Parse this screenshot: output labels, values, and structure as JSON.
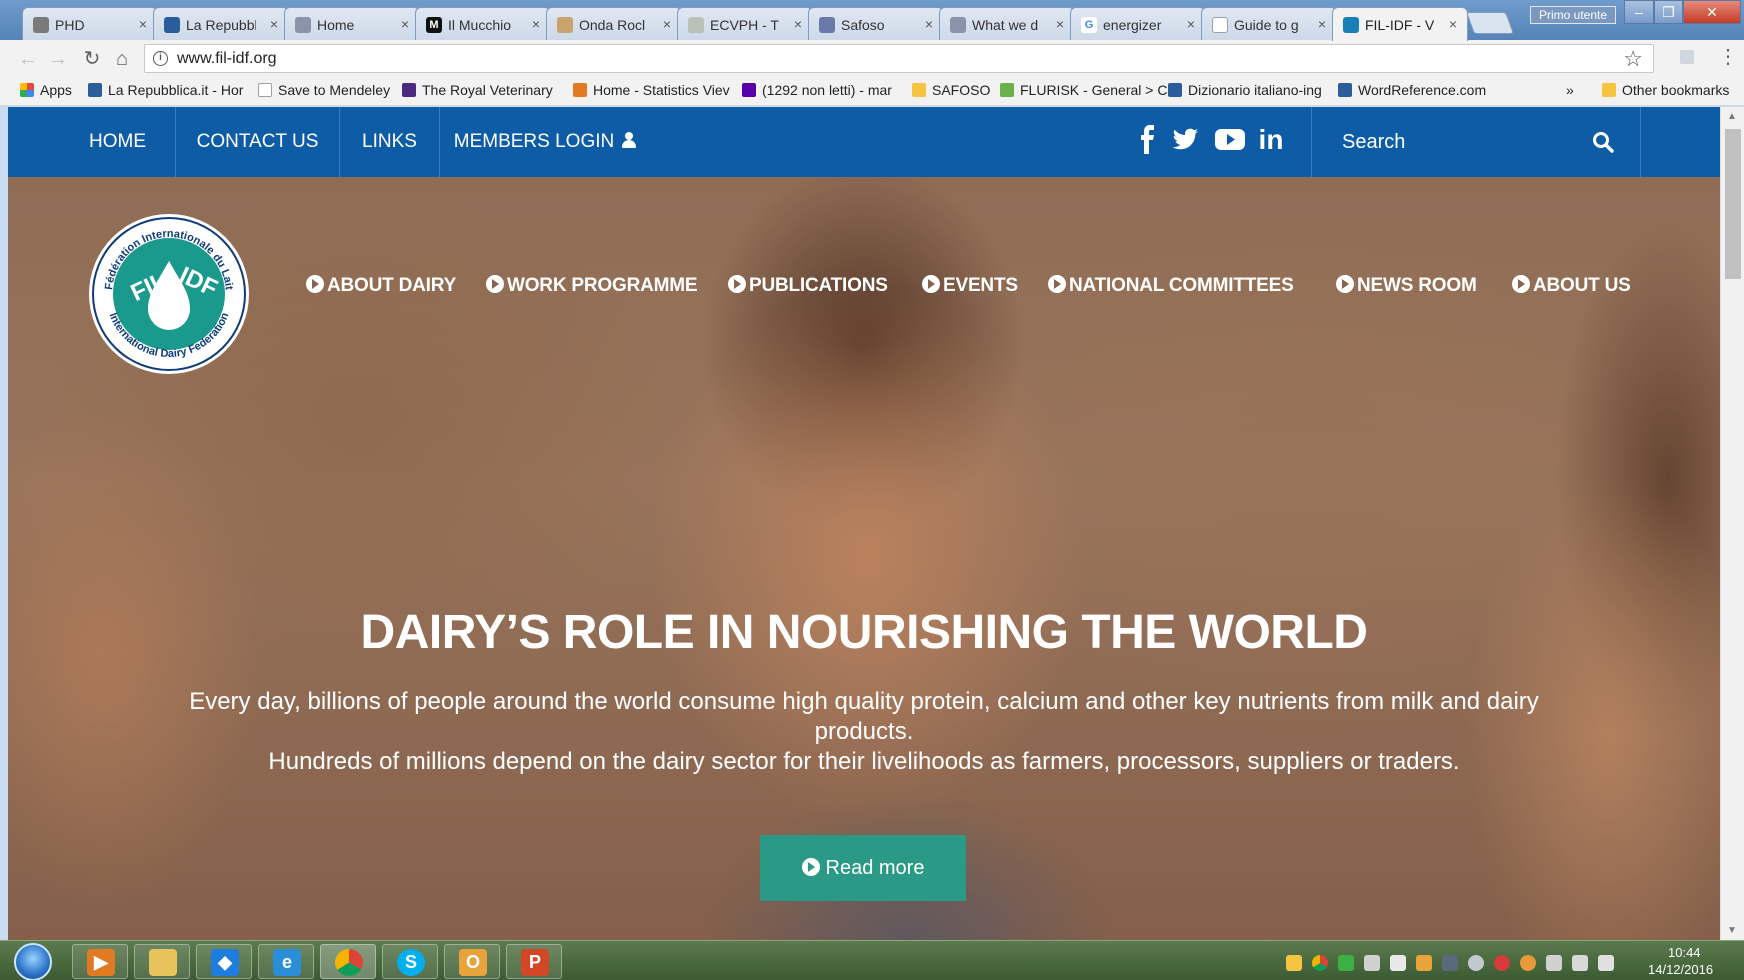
{
  "browser": {
    "tabs": [
      {
        "title": "PHD",
        "icon_color": "#7a7a7a"
      },
      {
        "title": "La Repubbl",
        "icon_color": "#2b5d9a"
      },
      {
        "title": "Home",
        "icon_color": "#8a93a8"
      },
      {
        "title": "Il Mucchio",
        "icon_color": "#111111"
      },
      {
        "title": "Onda Rocl",
        "icon_color": "#c8a46a"
      },
      {
        "title": "ECVPH - T",
        "icon_color": "#b8c0b8"
      },
      {
        "title": "Safoso",
        "icon_color": "#6a7aa8"
      },
      {
        "title": "What we d",
        "icon_color": "#8a93a8"
      },
      {
        "title": "energizer",
        "icon_color": "#4285f4"
      },
      {
        "title": "Guide to g",
        "icon_color": "#9aa0a6"
      },
      {
        "title": "FIL-IDF - V",
        "icon_color": "#1a7fb8"
      }
    ],
    "tab_close_glyph": "×",
    "profile_name": "Primo utente",
    "url": "www.fil-idf.org",
    "bookmarks": [
      {
        "label": "Apps",
        "icon_color": "#e34b3c"
      },
      {
        "label": "La Repubblica.it - Hor",
        "icon_color": "#2b5d9a"
      },
      {
        "label": "Save to Mendeley",
        "icon_color": "#9aa0a6"
      },
      {
        "label": "The Royal Veterinary",
        "icon_color": "#4b2a7f"
      },
      {
        "label": "Home - Statistics Viev",
        "icon_color": "#e07b24"
      },
      {
        "label": "(1292 non letti) - mar",
        "icon_color": "#5a00a8"
      },
      {
        "label": "SAFOSO",
        "icon_color": "#f5c542"
      },
      {
        "label": "FLURISK - General > C",
        "icon_color": "#6ab04c"
      },
      {
        "label": "Dizionario italiano-ing",
        "icon_color": "#2b5d9a"
      },
      {
        "label": "WordReference.com",
        "icon_color": "#2b5d9a"
      }
    ],
    "bookmarks_overflow": "»",
    "other_bookmarks": "Other bookmarks"
  },
  "site": {
    "top_nav": [
      "HOME",
      "CONTACT US",
      "LINKS",
      "MEMBERS LOGIN"
    ],
    "social": [
      "f",
      "twitter",
      "youtube",
      "in"
    ],
    "search_placeholder": "Search",
    "logo": {
      "ring_top": "Fédération Internationale du Lait",
      "ring_bottom": "International Dairy Federation",
      "left": "FIL",
      "right": "IDF",
      "teal": "#1a9a8c",
      "navy": "#0f3d7a"
    },
    "main_nav": [
      "ABOUT DAIRY",
      "WORK PROGRAMME",
      "PUBLICATIONS",
      "EVENTS",
      "NATIONAL COMMITTEES",
      "NEWS ROOM",
      "ABOUT US"
    ],
    "hero": {
      "title": "DAIRY’S ROLE IN NOURISHING THE WORLD",
      "line1": "Every day, billions of people around the world consume high quality protein, calcium and other key nutrients from milk and dairy products.",
      "line2": "Hundreds of millions depend on the dairy sector for their livelihoods as farmers, processors, suppliers or traders.",
      "button": "Read more"
    },
    "colors": {
      "topbar": "#0f5ca6",
      "button": "#2a9a86"
    }
  },
  "taskbar": {
    "time": "10:44",
    "date": "14/12/2016"
  }
}
